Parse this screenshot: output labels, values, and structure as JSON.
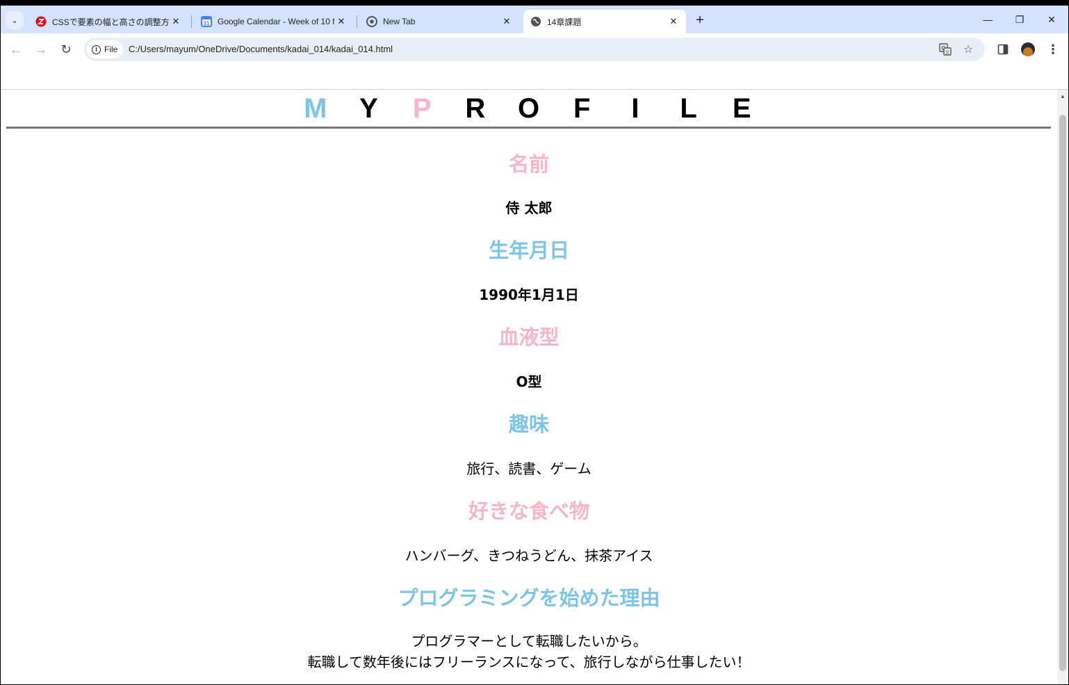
{
  "browser": {
    "tabs": [
      {
        "title": "CSSで要素の幅と高さの調整方法を",
        "favicon": "samurai-icon",
        "close": "✕"
      },
      {
        "title": "Google Calendar - Week of 10 f",
        "favicon": "calendar-icon",
        "favicon_text": "31",
        "close": "✕"
      },
      {
        "title": "New Tab",
        "favicon": "chrome-icon",
        "close": "✕"
      },
      {
        "title": "14章課題",
        "favicon": "globe-icon",
        "close": "✕",
        "active": true
      }
    ],
    "new_tab": "+",
    "window_controls": {
      "minimize": "—",
      "restore": "❐",
      "close": "✕"
    },
    "address": {
      "chip_label": "File",
      "url": "C:/Users/mayum/OneDrive/Documents/kadai_014/kadai_014.html"
    }
  },
  "page": {
    "title_letters": [
      "M",
      "Y",
      "P",
      "R",
      "O",
      "F",
      "I",
      "L",
      "E"
    ],
    "title_letter_colors": [
      "#7ec4e4",
      "#000000",
      "#f6b6c6",
      "#000000",
      "#000000",
      "#000000",
      "#000000",
      "#000000",
      "#000000"
    ],
    "sections": [
      {
        "heading": "名前",
        "color": "pink",
        "value": "侍 太郎",
        "bold": true
      },
      {
        "heading": "生年月日",
        "color": "blue",
        "value": "1990年1月1日",
        "bold": true
      },
      {
        "heading": "血液型",
        "color": "pink",
        "value": "O型",
        "bold": true
      },
      {
        "heading": "趣味",
        "color": "blue",
        "value": "旅行、読書、ゲーム",
        "bold": false
      },
      {
        "heading": "好きな食べ物",
        "color": "pink",
        "value": "ハンバーグ、きつねうどん、抹茶アイス",
        "bold": false
      },
      {
        "heading": "プログラミングを始めた理由",
        "color": "blue",
        "value": "プログラマーとして転職したいから。",
        "value2": "転職して数年後にはフリーランスになって、旅行しながら仕事したい！",
        "bold": false
      }
    ]
  },
  "colors": {
    "pink": "#f6b6c6",
    "blue": "#7ec4e4",
    "tabstrip": "#d3e3fd"
  }
}
